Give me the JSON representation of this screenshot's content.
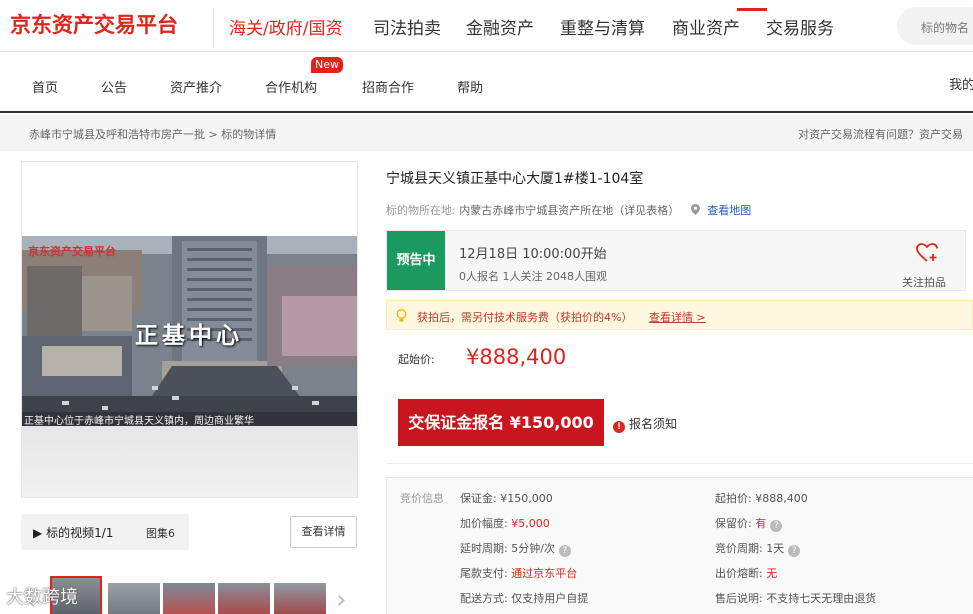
{
  "brand": {
    "logo_text": "京东资产交易平台",
    "accent": "#e2231a"
  },
  "top_nav": [
    "海关/政府/国资",
    "司法拍卖",
    "金融资产",
    "重整与清算",
    "商业资产",
    "交易服务"
  ],
  "search": {
    "placeholder": "标的物名"
  },
  "sub_nav": {
    "items": [
      "首页",
      "公告",
      "资产推介",
      "合作机构",
      "招商合作",
      "帮助"
    ],
    "new_badge": "New",
    "right_text": "我的"
  },
  "breadcrumb": {
    "path": "赤峰市宁城县及呼和浩特市房产一批  >  标的物详情",
    "help": "对资产交易流程有问题？资产交易"
  },
  "media": {
    "photo_sign": "正基中心",
    "photo_caption": "正基中心位于赤峰市宁城县天义镇内，周边商业繁华",
    "photo_logo": "京东资产交易平台",
    "video_tab": "标的视频1/1",
    "gallery_tab": "图集6",
    "detail_button": "查看详情",
    "watermark": "大数跨境"
  },
  "item": {
    "title": "宁城县天义镇正基中心大厦1#楼1-104室",
    "location_label": "标的物所在地:",
    "location_value": "内蒙古赤峰市宁城县资产所在地（详见表格）",
    "map_link": "查看地图"
  },
  "status": {
    "badge": "预告中",
    "badge_color": "#1a9a5e",
    "start_time": "12月18日 10:00:00开始",
    "stats": "0人报名  1人关注  2048人围观",
    "follow_label": "关注拍品"
  },
  "notice": {
    "text": "获拍后，需另付技术服务费（获拍价的4%）",
    "link": "查看详情 >"
  },
  "price": {
    "label": "起始价:",
    "value": "¥888,400"
  },
  "actions": {
    "bond_button": "交保证金报名 ¥150,000",
    "register_note": "报名须知"
  },
  "bid_info": {
    "title": "竞价信息",
    "left": [
      {
        "k": "保证金:",
        "v": "¥150,000"
      },
      {
        "k": "加价幅度:",
        "v": "¥5,000"
      },
      {
        "k": "延时周期:",
        "v": "5分钟/次"
      },
      {
        "k": "尾款支付:",
        "v": "通过京东平台"
      },
      {
        "k": "配送方式:",
        "v": "仅支持用户自提"
      }
    ],
    "right": [
      {
        "k": "起拍价:",
        "v": "¥888,400"
      },
      {
        "k": "保留价:",
        "v": "有"
      },
      {
        "k": "竞价周期:",
        "v": "1天"
      },
      {
        "k": "出价熔断:",
        "v": "无"
      },
      {
        "k": "售后说明:",
        "v": "不支持七天无理由退货"
      }
    ]
  }
}
